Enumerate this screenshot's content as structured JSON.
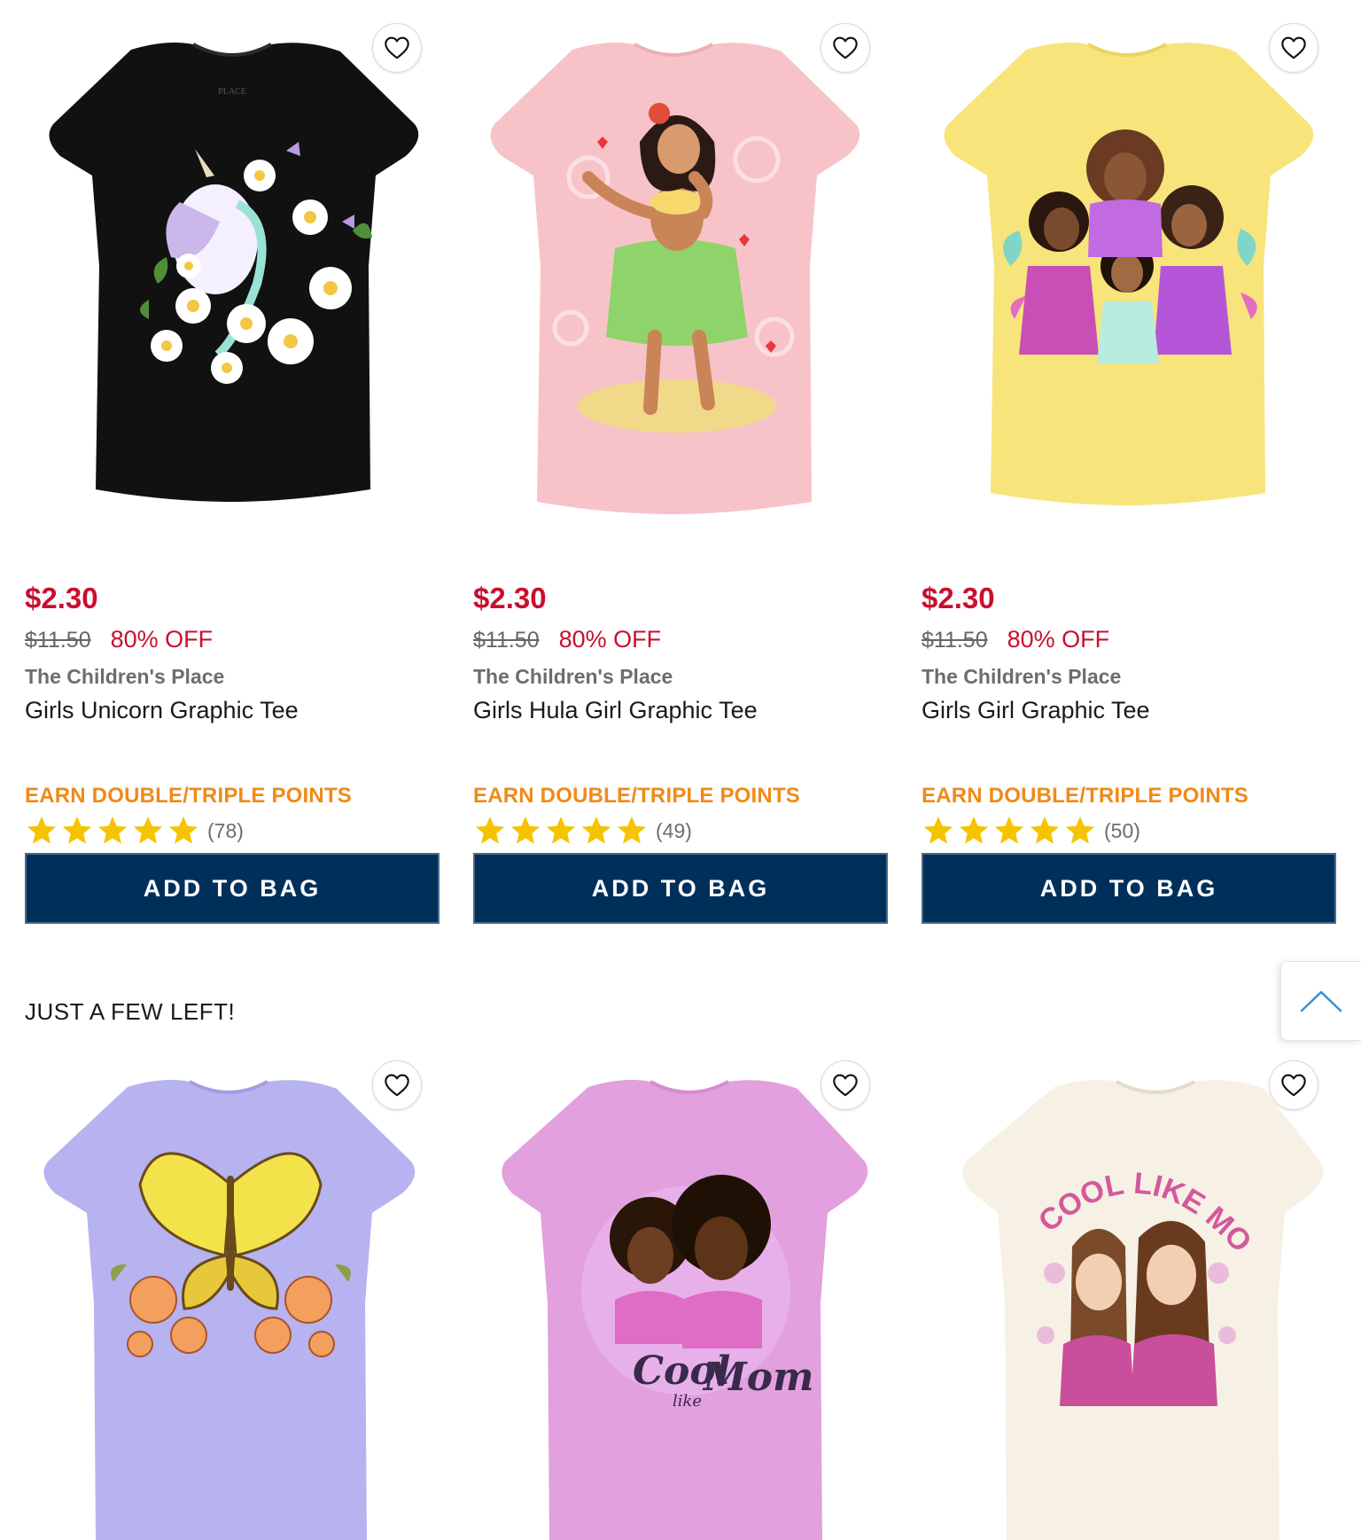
{
  "colors": {
    "sale_red": "#c8102e",
    "promo_orange": "#ef8a1a",
    "button_navy": "#00305a",
    "star_yellow": "#f5c400"
  },
  "products_top": [
    {
      "price": "$2.30",
      "was_price": "$11.50",
      "discount": "80% OFF",
      "brand": "The Children's Place",
      "name": "Girls Unicorn Graphic Tee",
      "promo": "EARN DOUBLE/TRIPLE POINTS",
      "rating": 5,
      "review_count": "(78)",
      "button": "ADD TO BAG",
      "tee_color": "#111111",
      "graphic": "unicorn with daisies"
    },
    {
      "price": "$2.30",
      "was_price": "$11.50",
      "discount": "80% OFF",
      "brand": "The Children's Place",
      "name": "Girls Hula Girl Graphic Tee",
      "promo": "EARN DOUBLE/TRIPLE POINTS",
      "rating": 5,
      "review_count": "(49)",
      "button": "ADD TO BAG",
      "tee_color": "#f7c3c8",
      "graphic": "hula girl"
    },
    {
      "price": "$2.30",
      "was_price": "$11.50",
      "discount": "80% OFF",
      "brand": "The Children's Place",
      "name": "Girls Girl Graphic Tee",
      "promo": "EARN DOUBLE/TRIPLE POINTS",
      "rating": 5,
      "review_count": "(50)",
      "button": "ADD TO BAG",
      "tee_color": "#f7e47a",
      "graphic": "group of girls"
    }
  ],
  "section_heading": "JUST A FEW LEFT!",
  "products_bottom": [
    {
      "tee_color": "#b7b3f0",
      "graphic": "yellow butterfly with flowers"
    },
    {
      "tee_color": "#e2a0df",
      "graphic": "Cool like Mom duo",
      "print_text_1": "Cool",
      "print_text_2": "like",
      "print_text_3": "Mom"
    },
    {
      "tee_color": "#f6f1e4",
      "graphic": "COOL LIKE MOM duo",
      "print_text_1": "COOL LIKE MOM"
    }
  ],
  "icons": {
    "wishlist": "heart-outline-icon",
    "back_to_top": "chevron-up-icon",
    "rating": "star-icon"
  }
}
